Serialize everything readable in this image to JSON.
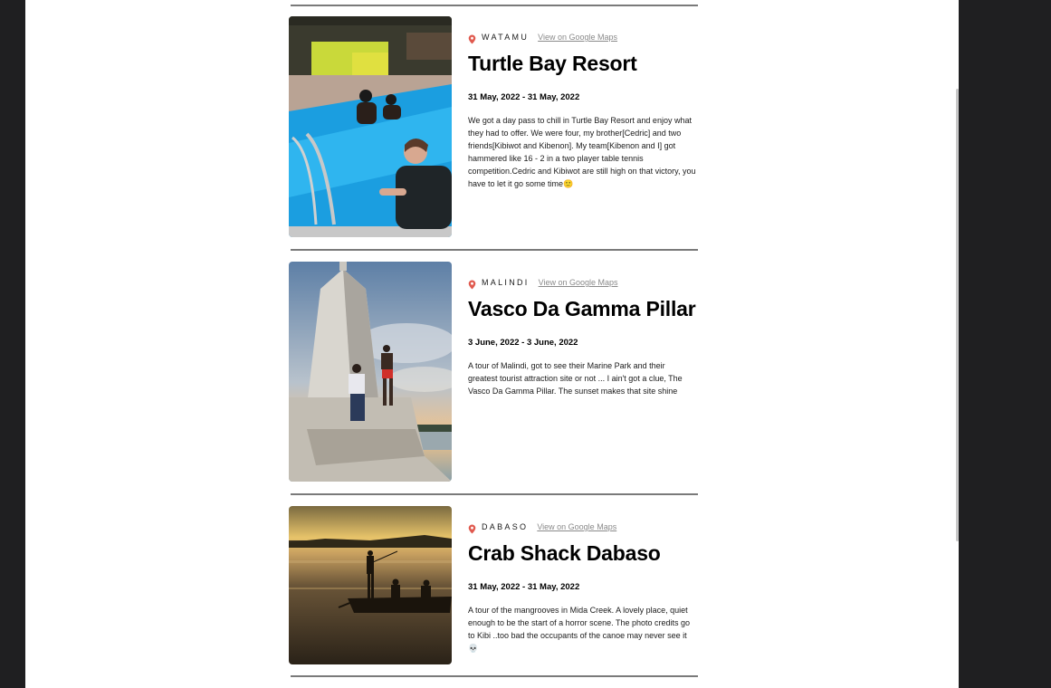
{
  "entries": [
    {
      "location": "WATAMU",
      "maps_link": "View on Google Maps",
      "title": "Turtle Bay Resort",
      "dates": "31 May, 2022 - 31 May, 2022",
      "description": "We got a day pass to chill in Turtle Bay Resort and enjoy what they had to offer. We were four, my brother[Cedric] and two friends[Kibiwot and Kibenon]. My team[Kibenon and I] got hammered like 16 - 2 in a two player table tennis competition.Cedric and Kibiwot are still high on that victory, you have to let it go some time🙂"
    },
    {
      "location": "MALINDI",
      "maps_link": "View on Google Maps",
      "title": "Vasco Da Gamma Pillar",
      "dates": "3 June, 2022 - 3 June, 2022",
      "description": "A tour of Malindi, got to see their Marine Park and their greatest tourist attraction site or not ... I ain't got a clue, The Vasco Da Gamma Pillar. The sunset makes that site shine"
    },
    {
      "location": "DABASO",
      "maps_link": "View on Google Maps",
      "title": "Crab Shack Dabaso",
      "dates": "31 May, 2022 - 31 May, 2022",
      "description": "A tour of the mangrooves in Mida Creek. A lovely place, quiet enough to be the start of a horror scene. The photo credits go to Kibi ..too bad the occupants of the canoe may never see it 💀"
    }
  ],
  "colors": {
    "pin": "#e05a4f",
    "divider": "#7a7a7a",
    "frame": "#1f1f21"
  },
  "icons": {
    "pin": "map-pin-icon"
  }
}
